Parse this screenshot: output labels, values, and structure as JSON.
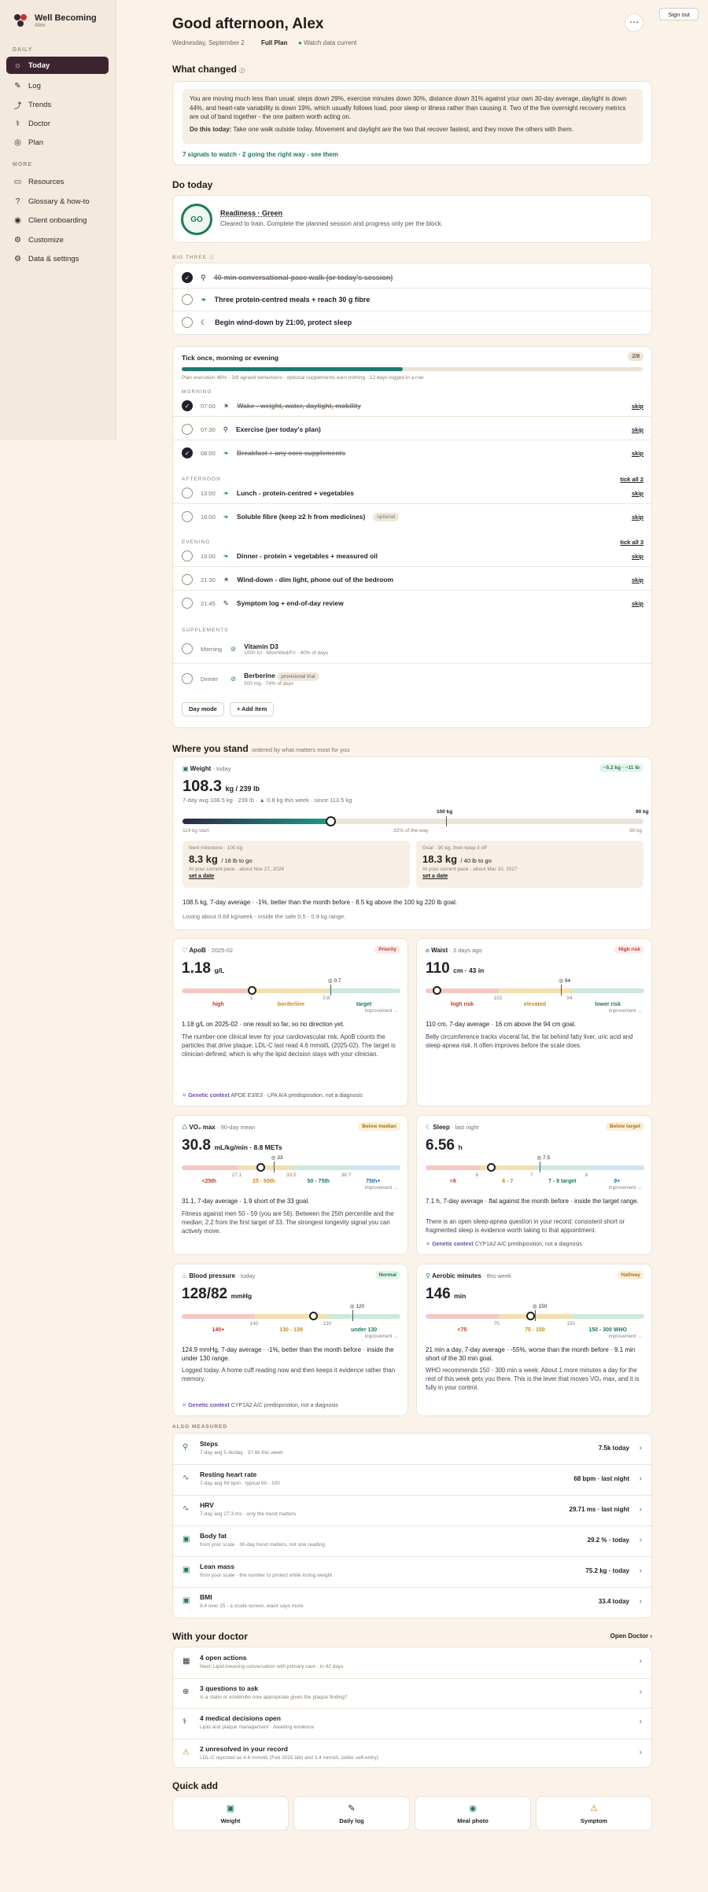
{
  "app": {
    "name": "Well Becoming",
    "user": "Alex"
  },
  "nav": {
    "daily_h": "DAILY",
    "more_h": "MORE",
    "items": [
      "Today",
      "Log",
      "Trends",
      "Doctor",
      "Plan"
    ],
    "more": [
      "Resources",
      "Glossary & how-to",
      "Client onboarding",
      "Customize",
      "Data & settings"
    ]
  },
  "header": {
    "title": "Good afternoon, Alex",
    "date": "Wednesday, September 2",
    "plan": "Full Plan",
    "watch": "Watch data current",
    "signout": "Sign out"
  },
  "changed": {
    "title": "What changed",
    "body": "You are moving much less than usual: steps down 29%, exercise minutes down 30%, distance down 31% against your own 30-day average, daylight is down 44%, and heart-rate variability is down 19%, which usually follows load, poor sleep or illness rather than causing it. Two of the five overnight recovery metrics are out of band together - the one pattern worth acting on.",
    "do_label": "Do this today:",
    "do_text": "Take one walk outside today. Movement and daylight are the two that recover fastest, and they move the others with them.",
    "link": "7 signals to watch · 2 going the right way - see them"
  },
  "today": {
    "title": "Do today",
    "ring": "GO",
    "readiness": "Readiness · Green",
    "readiness_sub": "Cleared to train. Complete the planned session and progress only per the block.",
    "big3": "BIG THREE",
    "b1": "40-min conversational-pace walk (or today's session)",
    "b2": "Three protein-centred meals + reach 30 g fibre",
    "b3": "Begin wind-down by 21:00, protect sleep"
  },
  "tick": {
    "title": "Tick once, morning or evening",
    "count": "2/8",
    "sub": "Plan execution 48% · 3/8 agreed behaviours · optional supplements earn nothing · 12 days logged in a row",
    "progress": 0.48,
    "morning": "MORNING",
    "afternoon": "AFTERNOON",
    "evening": "EVENING",
    "supplements": "SUPPLEMENTS",
    "tick_all2": "tick all 2",
    "tick_all3": "tick all 3",
    "skip": "skip",
    "m": [
      [
        "07:00",
        "Wake - weight, water, daylight, mobility"
      ],
      [
        "07:30",
        "Exercise (per today's plan)"
      ],
      [
        "08:00",
        "Breakfast + any core supplements"
      ]
    ],
    "a": [
      [
        "13:00",
        "Lunch - protein-centred + vegetables"
      ],
      [
        "16:00",
        "Soluble fibre (keep ≥2 h from medicines)"
      ]
    ],
    "optional": "optional",
    "e": [
      [
        "19:00",
        "Dinner - protein + vegetables + measured oil"
      ],
      [
        "21:30",
        "Wind-down - dim light, phone out of the bedroom"
      ],
      [
        "21:45",
        "Symptom log + end-of-day review"
      ]
    ],
    "s1_when": "Morning",
    "s1_name": "Vitamin D3",
    "s1_sub": "1000 IU · Mon/Wed/Fri · 40% of days",
    "s2_when": "Dinner",
    "s2_name": "Berberine",
    "s2_tag": "provisional trial",
    "s2_sub": "500 mg · 74% of days",
    "day_mode": "Day mode",
    "add": "+ Add item"
  },
  "stand": {
    "title": "Where you stand",
    "sub": "ordered by what matters most for you"
  },
  "weight": {
    "label": "Weight",
    "when": "· today",
    "delta": "−5.2 kg · −11 lb",
    "value": "108.3",
    "unit": "kg / 239 lb",
    "line": "7-day avg 108.5 kg · 239 lb · ▲ 0.8 kg this week · since 113.5 kg",
    "m100": "100 kg",
    "m90": "90 kg",
    "start": "114 kg start",
    "pct": "32% of the way",
    "end": "90 kg",
    "progress": 0.32,
    "ms_h": "Next milestone · 100 kg",
    "ms_v": "8.3 kg",
    "ms_u": "/ 18 lb to go",
    "ms_s": "At your current pace · about Nov 27, 2026",
    "goal_h": "Goal · 90 kg, then keep it off",
    "goal_v": "18.3 kg",
    "goal_u": "/ 40 lb to go",
    "goal_s": "At your current pace · about Mar 10, 2027",
    "set": "set a date",
    "foot": "108.5 kg, 7-day average · -1%, better than the month before · 8.5 kg above the 100 kg 220 lb goal.",
    "foot2": "Losing about 0.68 kg/week - inside the safe 0.5 - 0.9 kg range."
  },
  "apob": {
    "label": "ApoB",
    "when": "· 2025-02",
    "tag": "Priority",
    "value": "1.18",
    "unit": "g/L",
    "tick": "0.7",
    "z": [
      "high",
      "borderline",
      "target"
    ],
    "n": [
      "1",
      "0.8"
    ],
    "imp": "improvement →",
    "l1": "1.18 g/L on 2025-02 · one result so far, so no direction yet.",
    "l2": "The number-one clinical lever for your cardiovascular risk. ApoB counts the particles that drive plaque; LDL-C last read 4.6 mmol/L (2025-02). The target is clinician-defined, which is why the lipid decision stays with your clinician.",
    "gen": "Genetic context",
    "gen2": "APOE E3/E3 · LPA A/A predisposition, not a diagnosis"
  },
  "waist": {
    "label": "Waist",
    "when": "· 3 days ago",
    "tag": "High risk",
    "value": "110",
    "unit": "cm · 43 in",
    "tick": "94",
    "z": [
      "high risk",
      "elevated",
      "lower risk"
    ],
    "n": [
      "102",
      "94"
    ],
    "imp": "improvement →",
    "l1": "110 cm, 7-day average · 16 cm above the 94 cm goal.",
    "l2": "Belly circumference tracks visceral fat, the fat behind fatty liver, uric acid and sleep-apnea risk. It often improves before the scale does."
  },
  "vo2": {
    "label": "VO₂ max",
    "when": "· 90-day mean",
    "tag": "Below median",
    "value": "30.8",
    "unit": "mL/kg/min · 8.8 METs",
    "tick": "33",
    "n": [
      "27.1",
      "33.5",
      "38.7"
    ],
    "z": [
      "<25th",
      "25 - 50th",
      "50 - 75th",
      "75th+"
    ],
    "imp": "improvement →",
    "l1": "31.1, 7-day average · 1.9 short of the 33 goal.",
    "l2": "Fitness against men 50 - 59 (you are 56). Between the 25th percentile and the median; 2.2 from the first target of 33. The strongest longevity signal you can actively move."
  },
  "sleep": {
    "label": "Sleep",
    "when": "· last night",
    "tag": "Below target",
    "value": "6.56",
    "unit": "h",
    "tick": "7.5",
    "n": [
      "6",
      "7",
      "8"
    ],
    "z": [
      "<6",
      "6 - 7",
      "7 - 9 target",
      "9+"
    ],
    "imp": "improvement →",
    "l1": "7.1 h, 7-day average · flat against the month before · inside the target range.",
    "l2": "There is an open sleep-apnea question in your record: consistent short or fragmented sleep is evidence worth taking to that appointment.",
    "gen": "Genetic context",
    "gen2": "CYP1A2 A/C predisposition, not a diagnosis"
  },
  "bp": {
    "label": "Blood pressure",
    "when": "· today",
    "tag": "Normal",
    "value": "128/82",
    "unit": "mmHg",
    "tick": "120",
    "n": [
      "140",
      "130"
    ],
    "z": [
      "140+",
      "130 - 139",
      "under 130"
    ],
    "imp": "improvement →",
    "l1": "124.9 mmHg, 7-day average · -1%, better than the month before · inside the under 130 range.",
    "l2": "Logged today. A home cuff reading now and then keeps it evidence rather than memory.",
    "gen": "Genetic context",
    "gen2": "CYP1A2 A/C predisposition, not a diagnosis"
  },
  "aero": {
    "label": "Aerobic minutes",
    "when": "· this week",
    "tag": "Halfway",
    "value": "146",
    "unit": "min",
    "tick": "150",
    "n": [
      "75",
      "150"
    ],
    "z": [
      "<75",
      "75 - 150",
      "150 - 300 WHO"
    ],
    "imp": "improvement →",
    "l1": "21 min a day, 7-day average · -55%, worse than the month before · 9.1 min short of the 30 min goal.",
    "l2": "WHO recommends 150 - 300 min a week. About 1 more minutes a day for the rest of this week gets you there. This is the lever that moves VO₂ max, and it is fully in your control."
  },
  "also": {
    "title": "ALSO MEASURED",
    "items": [
      [
        "Steps",
        "7-day avg 5.4k/day · 37.6k this week",
        "7.5k today"
      ],
      [
        "Resting heart rate",
        "7-day avg 69 bpm · typical 60 - 100",
        "68 bpm · last night"
      ],
      [
        "HRV",
        "7-day avg 27.3 ms · only the trend matters",
        "29.71 ms · last night"
      ],
      [
        "Body fat",
        "from your scale · 30-day trend matters, not one reading",
        "29.2 % · today"
      ],
      [
        "Lean mass",
        "from your scale · the number to protect while losing weight",
        "75.2 kg · today"
      ],
      [
        "BMI",
        "9.4 over 25 · a crude screen, waist says more",
        "33.4 today"
      ]
    ]
  },
  "doctor": {
    "title": "With your doctor",
    "open": "Open Doctor ›",
    "items": [
      [
        "4 open actions",
        "Next: Lipid-lowering conversation with primary care · in 42 days"
      ],
      [
        "3 questions to ask",
        "Is a statin or ezetimibe now appropriate given the plaque finding?"
      ],
      [
        "4 medical decisions open",
        "Lipid and plaque management · Awaiting evidence"
      ],
      [
        "2 unresolved in your record",
        "LDL-C reported as 4.6 mmol/L (Feb 2025 lab) and 3.4 mmol/L (older self-entry)"
      ]
    ]
  },
  "quick": {
    "title": "Quick add",
    "items": [
      "Weight",
      "Daily log",
      "Meal photo",
      "Symptom"
    ]
  },
  "colors": {
    "accent": "#3b2430",
    "green": "#1f7a53",
    "red": "#c0392b",
    "amber": "#c98a1a"
  }
}
